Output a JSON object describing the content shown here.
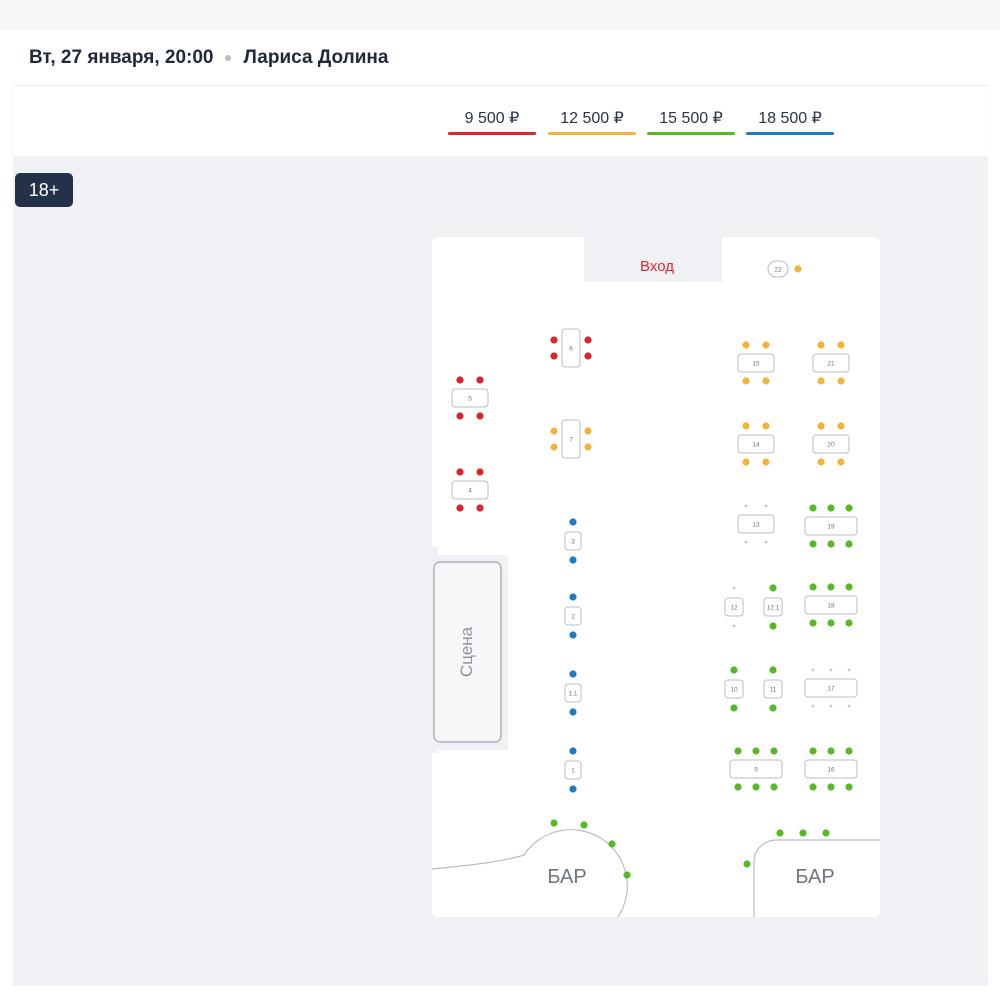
{
  "event": {
    "date": "Вт, 27 января, 20:00",
    "artist": "Лариса Долина"
  },
  "prices": [
    {
      "label": "9 500 ₽",
      "color": "#d9252b"
    },
    {
      "label": "12 500 ₽",
      "color": "#f2b53a"
    },
    {
      "label": "15 500 ₽",
      "color": "#58b927"
    },
    {
      "label": "18 500 ₽",
      "color": "#1f7ac4"
    }
  ],
  "age_badge": "18+",
  "hall": {
    "entrance": "Вход",
    "stage": "Сцена",
    "bar_left": "БАР",
    "bar_right": "БАР",
    "seat_colors": {
      "red": "#d9252b",
      "yellow": "#f2b53a",
      "green": "#58b927",
      "blue": "#1f7ac4",
      "empty": "#c4c8ce"
    },
    "tables": [
      {
        "label": "22",
        "color": "yellow"
      },
      {
        "label": "6",
        "color": "red"
      },
      {
        "label": "5",
        "color": "red"
      },
      {
        "label": "4",
        "color": "red"
      },
      {
        "label": "7",
        "color": "yellow"
      },
      {
        "label": "3",
        "color": "blue"
      },
      {
        "label": "2",
        "color": "blue"
      },
      {
        "label": "1.1",
        "color": "blue"
      },
      {
        "label": "1",
        "color": "blue"
      },
      {
        "label": "15",
        "color": "yellow"
      },
      {
        "label": "21",
        "color": "yellow"
      },
      {
        "label": "14",
        "color": "yellow"
      },
      {
        "label": "20",
        "color": "yellow"
      },
      {
        "label": "13",
        "color": "empty"
      },
      {
        "label": "19",
        "color": "green"
      },
      {
        "label": "12",
        "color": "empty"
      },
      {
        "label": "12.1",
        "color": "green"
      },
      {
        "label": "18",
        "color": "green"
      },
      {
        "label": "10",
        "color": "green"
      },
      {
        "label": "11",
        "color": "green"
      },
      {
        "label": "17",
        "color": "empty"
      },
      {
        "label": "9",
        "color": "green"
      },
      {
        "label": "16",
        "color": "green"
      }
    ]
  }
}
